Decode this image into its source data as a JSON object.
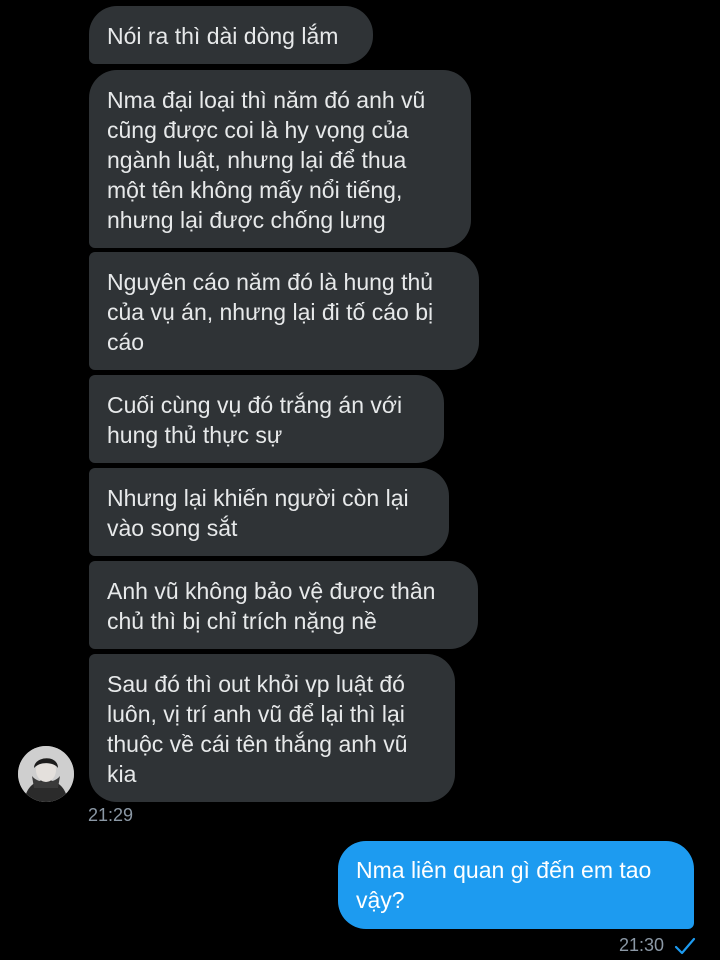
{
  "conversation": {
    "incoming": [
      {
        "text": "Nói ra thì dài dòng lắm"
      },
      {
        "text": "Nma đại loại thì năm đó anh vũ\ncũng được coi là hy vọng của\nngành luật, nhưng lại để thua\nmột tên không mấy nổi tiếng,\nnhưng lại được chống lưng"
      },
      {
        "text": "Nguyên cáo năm đó là hung thủ\ncủa vụ án, nhưng lại đi tố cáo bị\ncáo"
      },
      {
        "text": "Cuối cùng vụ đó trắng án với\nhung thủ thực sự"
      },
      {
        "text": "Nhưng lại khiến người còn lại\nvào song sắt"
      },
      {
        "text": "Anh vũ không bảo vệ được thân\nchủ thì bị chỉ trích nặng nề"
      },
      {
        "text": "Sau đó thì out khỏi vp luật đó\nluôn, vị trí anh vũ để lại thì lại\nthuộc về cái tên thắng anh vũ\nkia"
      }
    ],
    "incoming_time": "21:29",
    "outgoing": [
      {
        "text": "Nma liên quan gì đến em tao\nvậy?"
      }
    ],
    "outgoing_time": "21:30",
    "outgoing_status_icon": "check-icon",
    "avatar_icon": "user-avatar"
  },
  "colors": {
    "background": "#000000",
    "incoming_bubble": "#2f3336",
    "outgoing_bubble": "#1d9bf0",
    "timestamp": "#8b98a5"
  }
}
